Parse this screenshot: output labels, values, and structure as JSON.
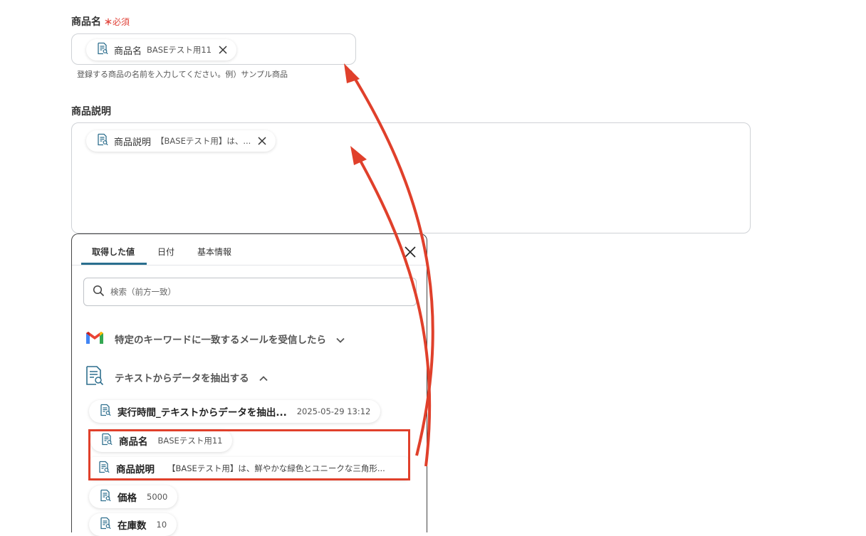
{
  "fields": {
    "product_name": {
      "label": "商品名",
      "required_mark": "＊",
      "required_text": "必須",
      "chip_name": "商品名",
      "chip_value": "BASEテスト用11",
      "hint": "登録する商品の名前を入力してください。例）サンプル商品"
    },
    "product_description": {
      "label": "商品説明",
      "chip_name": "商品説明",
      "chip_value": "【BASEテスト用】は、..."
    }
  },
  "panel": {
    "tabs": [
      {
        "label": "取得した値",
        "active": true
      },
      {
        "label": "日付",
        "active": false
      },
      {
        "label": "基本情報",
        "active": false
      }
    ],
    "search_placeholder": "検索（前方一致）",
    "sections": [
      {
        "icon": "gmail-icon",
        "title": "特定のキーワードに一致するメールを受信したら",
        "expanded": false
      },
      {
        "icon": "text-extract-icon",
        "title": "テキストからデータを抽出する",
        "expanded": true
      }
    ],
    "items": [
      {
        "name": "実行時間_テキストからデータを抽出...",
        "value": "2025-05-29 13:12"
      },
      {
        "name": "商品名",
        "value": "BASEテスト用11"
      },
      {
        "name": "商品説明",
        "value": "【BASEテスト用】は、鮮やかな緑色とユニークな三角形..."
      },
      {
        "name": "価格",
        "value": "5000"
      },
      {
        "name": "在庫数",
        "value": "10"
      }
    ]
  },
  "colors": {
    "accent_tab": "#2a6f8f",
    "required": "#e0433a",
    "annotation": "#e0402b",
    "icon_blue": "#2f6f8e"
  }
}
